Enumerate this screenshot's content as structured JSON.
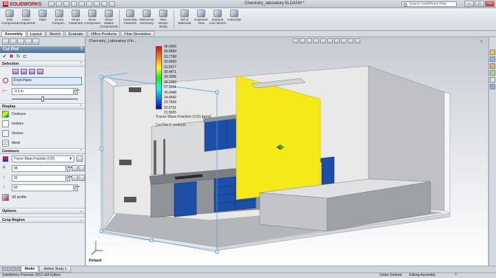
{
  "app": {
    "brand": "SOLIDWORKS",
    "doc_title": "Chemistry_laboratory.SLDASM *",
    "help_placeholder": "Search SolidWorks Help",
    "window_buttons": [
      "–",
      "□",
      "×"
    ]
  },
  "ribbon": {
    "tools": [
      {
        "label": "Edit Component",
        "icon": "edit-component-icon"
      },
      {
        "label": "Insert Components",
        "icon": "insert-components-icon"
      },
      {
        "label": "Mate",
        "icon": "mate-icon"
      },
      {
        "label": "Linear Compon...",
        "icon": "linear-pattern-icon"
      },
      {
        "label": "Smart Fasteners",
        "icon": "smart-fasteners-icon"
      },
      {
        "label": "Move Component",
        "icon": "move-component-icon"
      },
      {
        "label": "Show Hidden Components",
        "icon": "show-hidden-icon"
      },
      {
        "label": "Assembly Features",
        "icon": "assembly-features-icon"
      },
      {
        "label": "Reference Geometry",
        "icon": "reference-geometry-icon"
      },
      {
        "label": "New Motion Study",
        "icon": "motion-study-icon"
      },
      {
        "label": "Bill of Materials",
        "icon": "bom-icon"
      },
      {
        "label": "Exploded View",
        "icon": "exploded-view-icon"
      },
      {
        "label": "Explode Line Sketch",
        "icon": "explode-line-icon"
      },
      {
        "label": "Instant3D",
        "icon": "instant3d-icon"
      }
    ]
  },
  "tabs": [
    "Assembly",
    "Layout",
    "Sketch",
    "Evaluate",
    "Office Products",
    "Flow Simulation"
  ],
  "active_tab": "Assembly",
  "panel": {
    "title": "Cut Plot",
    "help": "?",
    "sections": {
      "selection": "Selection",
      "display": "Display",
      "contours": "Contours",
      "options": "Options",
      "crop_region": "Crop Region"
    },
    "plane_value": "Front Plane",
    "offset_value": "-3.5 in",
    "slider_fraction": 0.47,
    "display_options": [
      "Contours",
      "Isolines",
      "Vectors",
      "Mesh"
    ],
    "parameter_value": "Tracer Mass Fraction (CO)",
    "levels_value": "36",
    "field2_value": "32",
    "field3_value": "60",
    "profile_label": "3D profile"
  },
  "viewport": {
    "tree_label": "Chemistry_Laboratory (Flo...",
    "legend_values": [
      "36.0000",
      "34.6894",
      "33.7788",
      "32.6683",
      "31.5577",
      "30.4471",
      "29.3366",
      "28.2260",
      "27.1154",
      "26.0048",
      "24.8942",
      "23.7836",
      "22.6731",
      "21.5625"
    ],
    "legend_title": "Tracer Mass Fraction (CO) [ppm]",
    "legend_sub": "Cut Plot 2: contours",
    "view_label": "Default",
    "colors": {
      "plot_yellow": "#f6e91a",
      "cabinet_blue": "#1d4fa8",
      "counter_gray": "#8e9196",
      "selection_blue": "#4aa3e0"
    }
  },
  "bottom_tabs": [
    "Model",
    "Motion Study 1"
  ],
  "status": {
    "edition": "SolidWorks Premium 2012 x64 Edition",
    "under_defined": "Under Defined",
    "editing": "Editing Assembly",
    "help_mark": "?"
  }
}
